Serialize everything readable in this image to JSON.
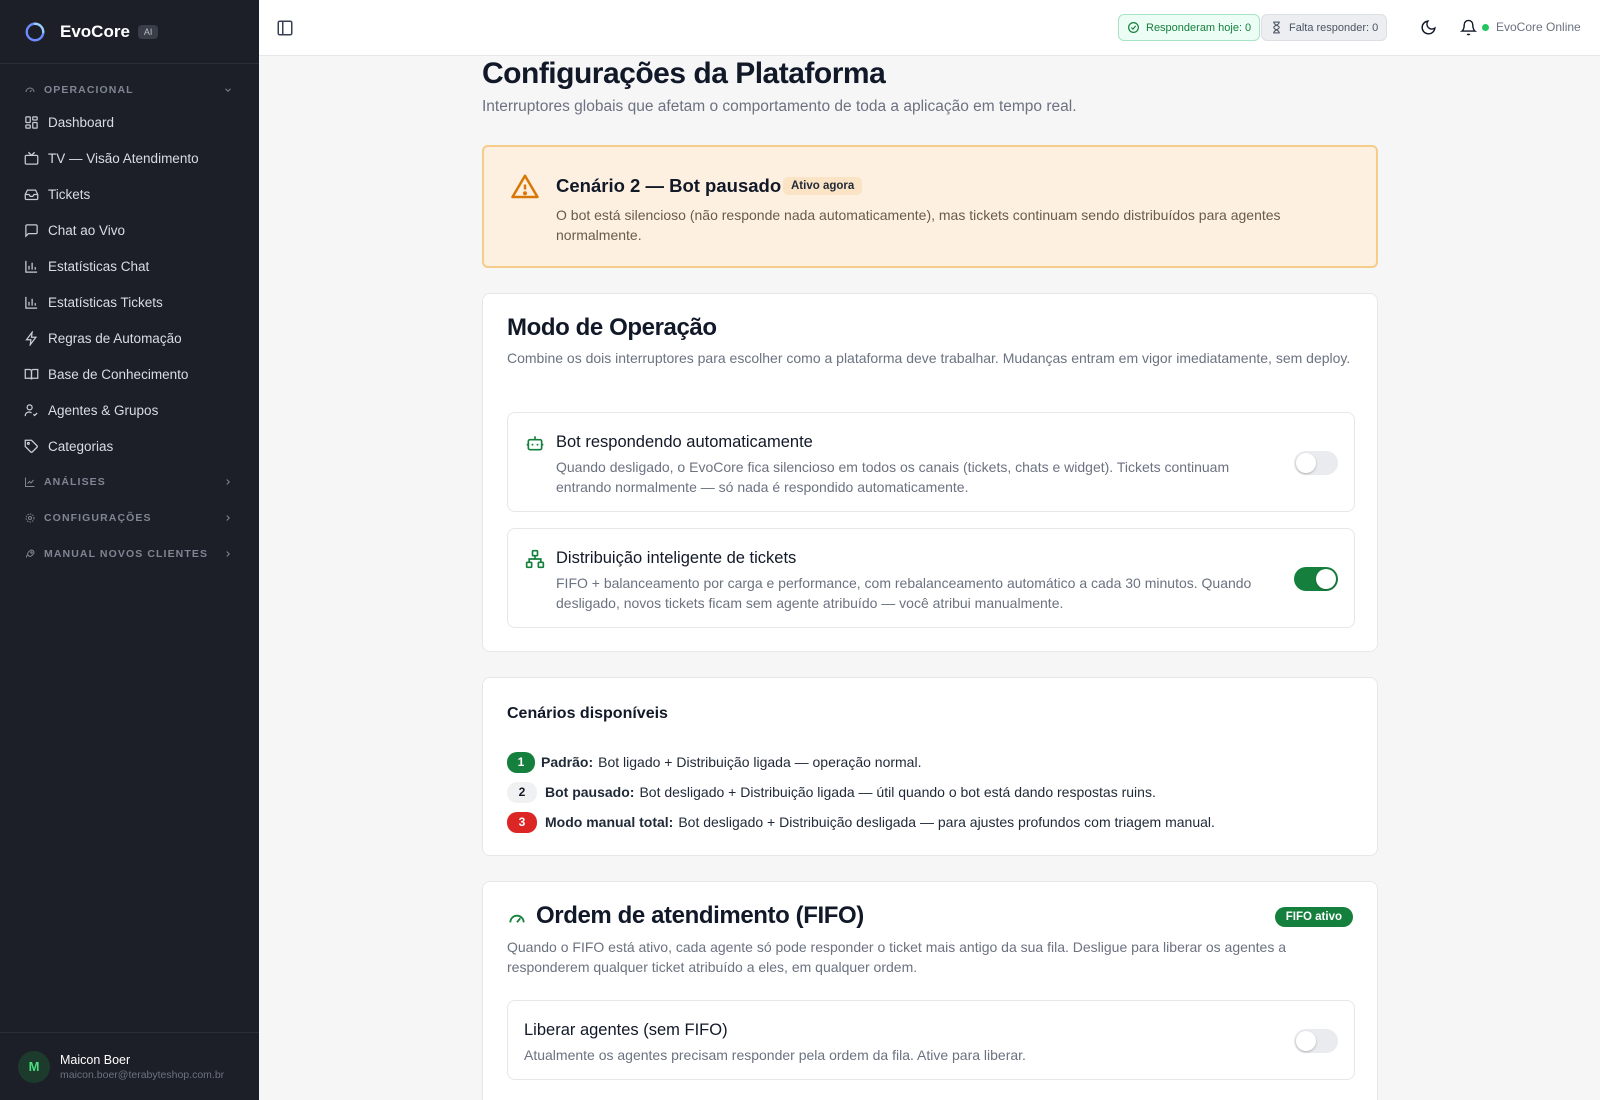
{
  "brand": {
    "name": "EvoCore",
    "badge": "AI"
  },
  "sidebar": {
    "sections": {
      "operacional": "OPERACIONAL",
      "analises": "ANÁLISES",
      "configuracoes": "CONFIGURAÇÕES",
      "manual": "MANUAL NOVOS CLIENTES"
    },
    "items": [
      {
        "label": "Dashboard",
        "icon": "dashboard-icon"
      },
      {
        "label": "TV — Visão Atendimento",
        "icon": "tv-icon"
      },
      {
        "label": "Tickets",
        "icon": "inbox-icon"
      },
      {
        "label": "Chat ao Vivo",
        "icon": "chat-icon"
      },
      {
        "label": "Estatísticas Chat",
        "icon": "bar-chart-icon"
      },
      {
        "label": "Estatísticas Tickets",
        "icon": "bar-chart-icon"
      },
      {
        "label": "Regras de Automação",
        "icon": "lightning-icon"
      },
      {
        "label": "Base de Conhecimento",
        "icon": "book-icon"
      },
      {
        "label": "Agentes & Grupos",
        "icon": "user-check-icon"
      },
      {
        "label": "Categorias",
        "icon": "tag-icon"
      }
    ]
  },
  "user": {
    "initial": "M",
    "name": "Maicon Boer",
    "email": "maicon.boer@terabyteshop.com.br"
  },
  "topbar": {
    "answered_today": "Responderam hoje: 0",
    "pending": "Falta responder: 0",
    "status": "EvoCore Online"
  },
  "page": {
    "title": "Configurações da Plataforma",
    "subtitle": "Interruptores globais que afetam o comportamento de toda a aplicação em tempo real."
  },
  "alert": {
    "title": "Cenário 2 — Bot pausado",
    "badge": "Ativo agora",
    "text": "O bot está silencioso (não responde nada automaticamente), mas tickets continuam sendo distribuídos para agentes normalmente."
  },
  "mode": {
    "title": "Modo de Operação",
    "description": "Combine os dois interruptores para escolher como a plataforma deve trabalhar. Mudanças entram em vigor imediatamente, sem deploy.",
    "bot": {
      "title": "Bot respondendo automaticamente",
      "description": "Quando desligado, o EvoCore fica silencioso em todos os canais (tickets, chats e widget). Tickets continuam entrando normalmente — só nada é respondido automaticamente.",
      "enabled": false
    },
    "distribution": {
      "title": "Distribuição inteligente de tickets",
      "description": "FIFO + balanceamento por carga e performance, com rebalanceamento automático a cada 30 minutos. Quando desligado, novos tickets ficam sem agente atribuído — você atribui manualmente.",
      "enabled": true
    }
  },
  "scenarios": {
    "title": "Cenários disponíveis",
    "items": [
      {
        "num": "1",
        "name": "Padrão:",
        "text": "Bot ligado + Distribuição ligada — operação normal."
      },
      {
        "num": "2",
        "name": "Bot pausado:",
        "text": "Bot desligado + Distribuição ligada — útil quando o bot está dando respostas ruins."
      },
      {
        "num": "3",
        "name": "Modo manual total:",
        "text": "Bot desligado + Distribuição desligada — para ajustes profundos com triagem manual."
      }
    ]
  },
  "fifo": {
    "title": "Ordem de atendimento (FIFO)",
    "badge": "FIFO ativo",
    "description": "Quando o FIFO está ativo, cada agente só pode responder o ticket mais antigo da sua fila. Desligue para liberar os agentes a responderem qualquer ticket atribuído a eles, em qualquer ordem.",
    "release": {
      "title": "Liberar agentes (sem FIFO)",
      "description": "Atualmente os agentes precisam responder pela ordem da fila. Ative para liberar.",
      "enabled": false
    }
  },
  "colors": {
    "sidebar_bg": "#1c1f27",
    "accent_green": "#15803d",
    "alert_bg": "#fdf0e1",
    "alert_border": "#f6cc8a",
    "danger": "#dc2626"
  }
}
